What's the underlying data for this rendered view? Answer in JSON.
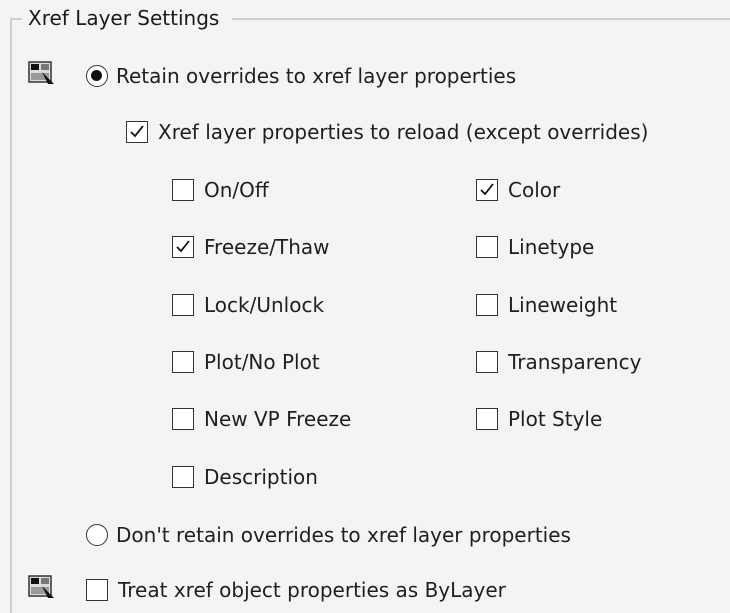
{
  "group": {
    "title": "Xref Layer Settings"
  },
  "retain_overrides": {
    "label": "Retain overrides to xref layer properties",
    "selected": true
  },
  "reload_properties": {
    "label": "Xref layer properties to reload (except overrides)",
    "checked": true
  },
  "properties_left": [
    {
      "label": "On/Off",
      "checked": false
    },
    {
      "label": "Freeze/Thaw",
      "checked": true
    },
    {
      "label": "Lock/Unlock",
      "checked": false
    },
    {
      "label": "Plot/No Plot",
      "checked": false
    },
    {
      "label": "New VP Freeze",
      "checked": false
    },
    {
      "label": "Description",
      "checked": false
    }
  ],
  "properties_right": [
    {
      "label": "Color",
      "checked": true
    },
    {
      "label": "Linetype",
      "checked": false
    },
    {
      "label": "Lineweight",
      "checked": false
    },
    {
      "label": "Transparency",
      "checked": false
    },
    {
      "label": "Plot Style",
      "checked": false
    }
  ],
  "dont_retain_overrides": {
    "label": "Don't retain overrides to xref layer properties",
    "selected": false
  },
  "treat_bylayer": {
    "label": "Treat xref object properties as ByLayer",
    "checked": false
  },
  "icons": {
    "layer_settings_icon": "xref-layer-icon",
    "object_props_icon": "xref-object-icon"
  }
}
